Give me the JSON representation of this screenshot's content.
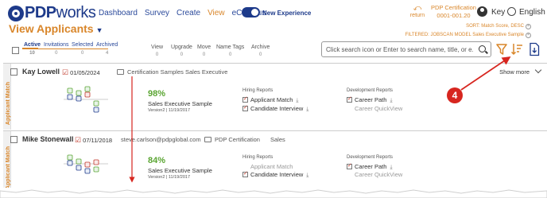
{
  "brand": {
    "logo": "PDPworks",
    "logo_bold": "PDP",
    "logo_light": "works"
  },
  "nav": {
    "items": [
      "Dashboard",
      "Survey",
      "Create",
      "View",
      "eCampus"
    ],
    "active": "View"
  },
  "toggle": {
    "label": "New Experience",
    "on": true
  },
  "header_right": {
    "return_label": "return",
    "cert_title": "PDP Certification",
    "cert_code": "0001-001.20",
    "user": "Key",
    "language": "English"
  },
  "page": {
    "title": "View Applicants"
  },
  "sort_filter": {
    "sort": "SORT: Match Score, DESC",
    "filter": "FILTERED: JOBSCAN MODEL Sales Executive Sample"
  },
  "tabs": [
    {
      "label": "Active",
      "count": "10"
    },
    {
      "label": "Invitations",
      "count": "0"
    },
    {
      "label": "Selected",
      "count": "0"
    },
    {
      "label": "Archived",
      "count": "4"
    }
  ],
  "columns": [
    {
      "label": "View",
      "count": "0"
    },
    {
      "label": "Upgrade",
      "count": "0"
    },
    {
      "label": "Move",
      "count": "0"
    },
    {
      "label": "Name Tags",
      "count": "0"
    },
    {
      "label": "Archive",
      "count": "0"
    }
  ],
  "search": {
    "placeholder": "Click search icon or Enter to search name, title, or e..."
  },
  "callout": {
    "number": "4"
  },
  "colors": {
    "accent": "#d9862a",
    "brand": "#1d3a8a",
    "score": "#5aa532",
    "callout": "#d7261f"
  },
  "applicants": [
    {
      "sidebar": "Applicant Match",
      "name": "Kay Lowell",
      "date": "01/05/2024",
      "email": "",
      "group": "Certification Samples",
      "title": "Sales Executive",
      "show_more": "Show more",
      "score": "98%",
      "model": "Sales Executive Sample",
      "version": "Version2 | 11/19/2017",
      "hiring_head": "Hiring Reports",
      "hiring": [
        {
          "label": "Applicant Match",
          "checked": true,
          "download": true
        },
        {
          "label": "Candidate Interview",
          "checked": true,
          "download": true
        }
      ],
      "dev_head": "Development Reports",
      "dev": [
        {
          "label": "Career Path",
          "checked": true,
          "download": true
        },
        {
          "label": "Career QuickView",
          "checked": false,
          "download": false
        }
      ]
    },
    {
      "sidebar": "Applicant Match",
      "name": "Mike Stonewall",
      "date": "07/11/2018",
      "email": "steve.carlson@pdpglobal.com",
      "group": "PDP Certification",
      "title": "Sales",
      "show_more": "",
      "score": "84%",
      "model": "Sales Executive Sample",
      "version": "Version2 | 11/19/2017",
      "hiring_head": "Hiring Reports",
      "hiring": [
        {
          "label": "Applicant Match",
          "checked": false,
          "download": false
        },
        {
          "label": "Candidate Interview",
          "checked": true,
          "download": true
        }
      ],
      "dev_head": "Development Reports",
      "dev": [
        {
          "label": "Career Path",
          "checked": true,
          "download": true
        },
        {
          "label": "Career QuickView",
          "checked": false,
          "download": false
        }
      ]
    }
  ]
}
